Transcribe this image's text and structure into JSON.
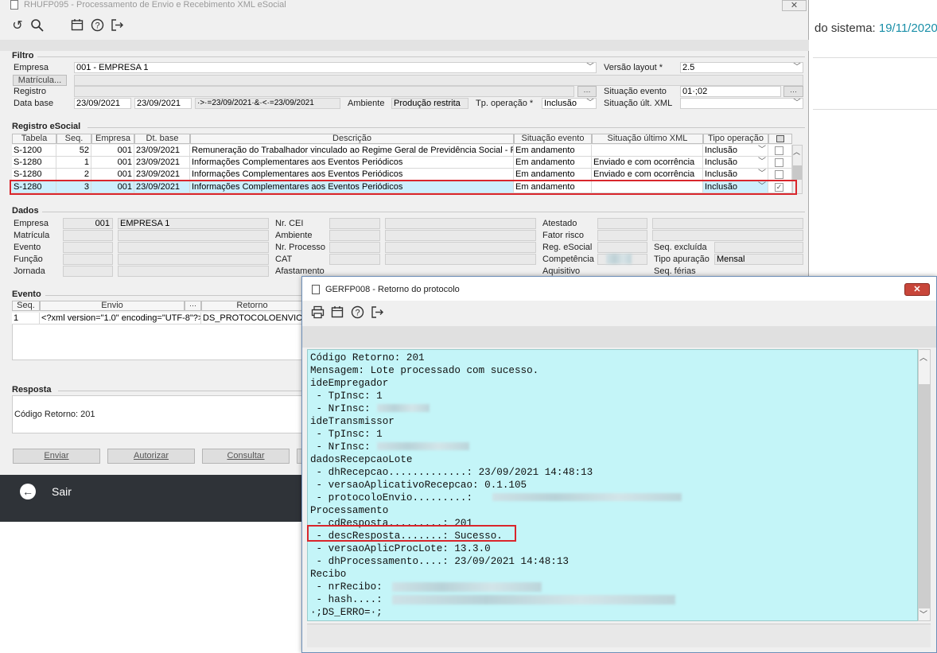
{
  "background_app": {
    "date_label": "do sistema:",
    "date_value": "19/11/2020"
  },
  "main_window": {
    "title": "RHUFP095 - Processamento de Envio e Recebimento XML eSocial",
    "close": "✕",
    "filtro": {
      "label": "Filtro",
      "empresa_label": "Empresa",
      "empresa_value": "001 - EMPRESA 1",
      "versao_label": "Versão layout *",
      "versao_value": "2.5",
      "matricula_button": "Matrícula...",
      "registro_label": "Registro",
      "situacao_evento_label": "Situação evento",
      "situacao_evento_value": "01·;02",
      "data_base_label": "Data base",
      "data_inicio": "23/09/2021",
      "data_fim": "23/09/2021",
      "data_expr": "·>·=23/09/2021·&·<·=23/09/2021",
      "ambiente_label": "Ambiente",
      "ambiente_value": "Produção restrita",
      "tp_operacao_label": "Tp. operação *",
      "tp_operacao_value": "Inclusão",
      "situacao_ult_label": "Situação últ. XML"
    },
    "registro": {
      "label": "Registro eSocial",
      "headers": [
        "Tabela",
        "Seq.",
        "Empresa",
        "Dt. base",
        "Descrição",
        "Situação evento",
        "Situação último XML",
        "Tipo operação"
      ],
      "rows": [
        {
          "tabela": "S-1200",
          "seq": "52",
          "empresa": "001",
          "dt": "23/09/2021",
          "descricao": "Remuneração do Trabalhador vinculado ao Regime Geral de Previdência Social - RG",
          "situacao": "Em andamento",
          "ultimo": "",
          "tipo": "Inclusão"
        },
        {
          "tabela": "S-1280",
          "seq": "1",
          "empresa": "001",
          "dt": "23/09/2021",
          "descricao": "Informações Complementares aos Eventos Periódicos",
          "situacao": "Em andamento",
          "ultimo": "Enviado e com ocorrência",
          "tipo": "Inclusão"
        },
        {
          "tabela": "S-1280",
          "seq": "2",
          "empresa": "001",
          "dt": "23/09/2021",
          "descricao": "Informações Complementares aos Eventos Periódicos",
          "situacao": "Em andamento",
          "ultimo": "Enviado e com ocorrência",
          "tipo": "Inclusão"
        },
        {
          "tabela": "S-1280",
          "seq": "3",
          "empresa": "001",
          "dt": "23/09/2021",
          "descricao": "Informações Complementares aos Eventos Periódicos",
          "situacao": "Em andamento",
          "ultimo": "",
          "tipo": "Inclusão"
        }
      ]
    },
    "dados": {
      "label": "Dados",
      "empresa_label": "Empresa",
      "empresa_code": "001",
      "empresa_name": "EMPRESA 1",
      "matricula_label": "Matrícula",
      "evento_label": "Evento",
      "funcao_label": "Função",
      "jornada_label": "Jornada",
      "nrcei_label": "Nr. CEI",
      "ambiente_label": "Ambiente",
      "nrprocesso_label": "Nr. Processo",
      "cat_label": "CAT",
      "afastamento_label": "Afastamento",
      "atestado_label": "Atestado",
      "fator_label": "Fator risco",
      "reg_label": "Reg. eSocial",
      "competencia_label": "Competência",
      "aquisitivo_label": "Aquisitivo",
      "seq_excluida_label": "Seq. excluída",
      "tipo_apuracao_label": "Tipo apuração",
      "tipo_apuracao_value": "Mensal",
      "seq_ferias_label": "Seq. férias"
    },
    "evento": {
      "label": "Evento",
      "headers": [
        "Seq.",
        "Envio",
        "Retorno"
      ],
      "row": {
        "seq": "1",
        "envio": "<?xml version=\"1.0\" encoding=\"UTF-8\"?>",
        "retorno": "DS_PROTOCOLOENVIO="
      }
    },
    "resposta": {
      "label": "Resposta",
      "text": "Código Retorno: 201"
    },
    "buttons": {
      "enviar": "Enviar",
      "autorizar": "Autorizar",
      "consultar": "Consultar"
    },
    "sair": "Sair"
  },
  "dialog": {
    "title": "GERFP008 - Retorno do protocolo",
    "close": "✕",
    "lines": [
      "Código Retorno: 201",
      "Mensagem: Lote processado com sucesso.",
      "ideEmpregador",
      " - TpInsc: 1",
      " - NrInsc: ",
      "ideTransmissor",
      " - TpInsc: 1",
      " - NrInsc: ",
      "dadosRecepcaoLote",
      " - dhRecepcao.............: 23/09/2021 14:48:13",
      " - versaoAplicativoRecepcao: 0.1.105",
      " - protocoloEnvio.........: ",
      "Processamento",
      " - cdResposta.........: 201",
      " - descResposta.......: Sucesso.",
      " - versaoAplicProcLote: 13.3.0",
      " - dhProcessamento....: 23/09/2021 14:48:13",
      "Recibo",
      " - nrRecibo: ",
      " - hash....: ",
      "·;DS_ERRO=·;"
    ]
  }
}
